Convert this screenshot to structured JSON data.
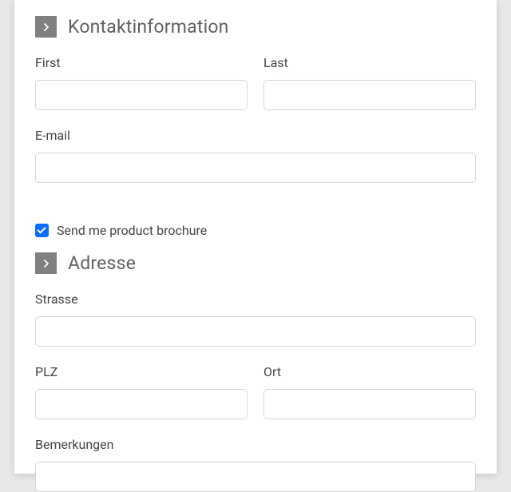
{
  "sections": {
    "contact": {
      "title": "Kontaktinformation",
      "fields": {
        "first": {
          "label": "First",
          "value": ""
        },
        "last": {
          "label": "Last",
          "value": ""
        },
        "email": {
          "label": "E-mail",
          "value": ""
        }
      }
    },
    "brochure": {
      "label": "Send me product brochure",
      "checked": true
    },
    "address": {
      "title": "Adresse",
      "fields": {
        "street": {
          "label": "Strasse",
          "value": ""
        },
        "zip": {
          "label": "PLZ",
          "value": ""
        },
        "city": {
          "label": "Ort",
          "value": ""
        },
        "notes": {
          "label": "Bemerkungen",
          "value": ""
        }
      }
    }
  }
}
